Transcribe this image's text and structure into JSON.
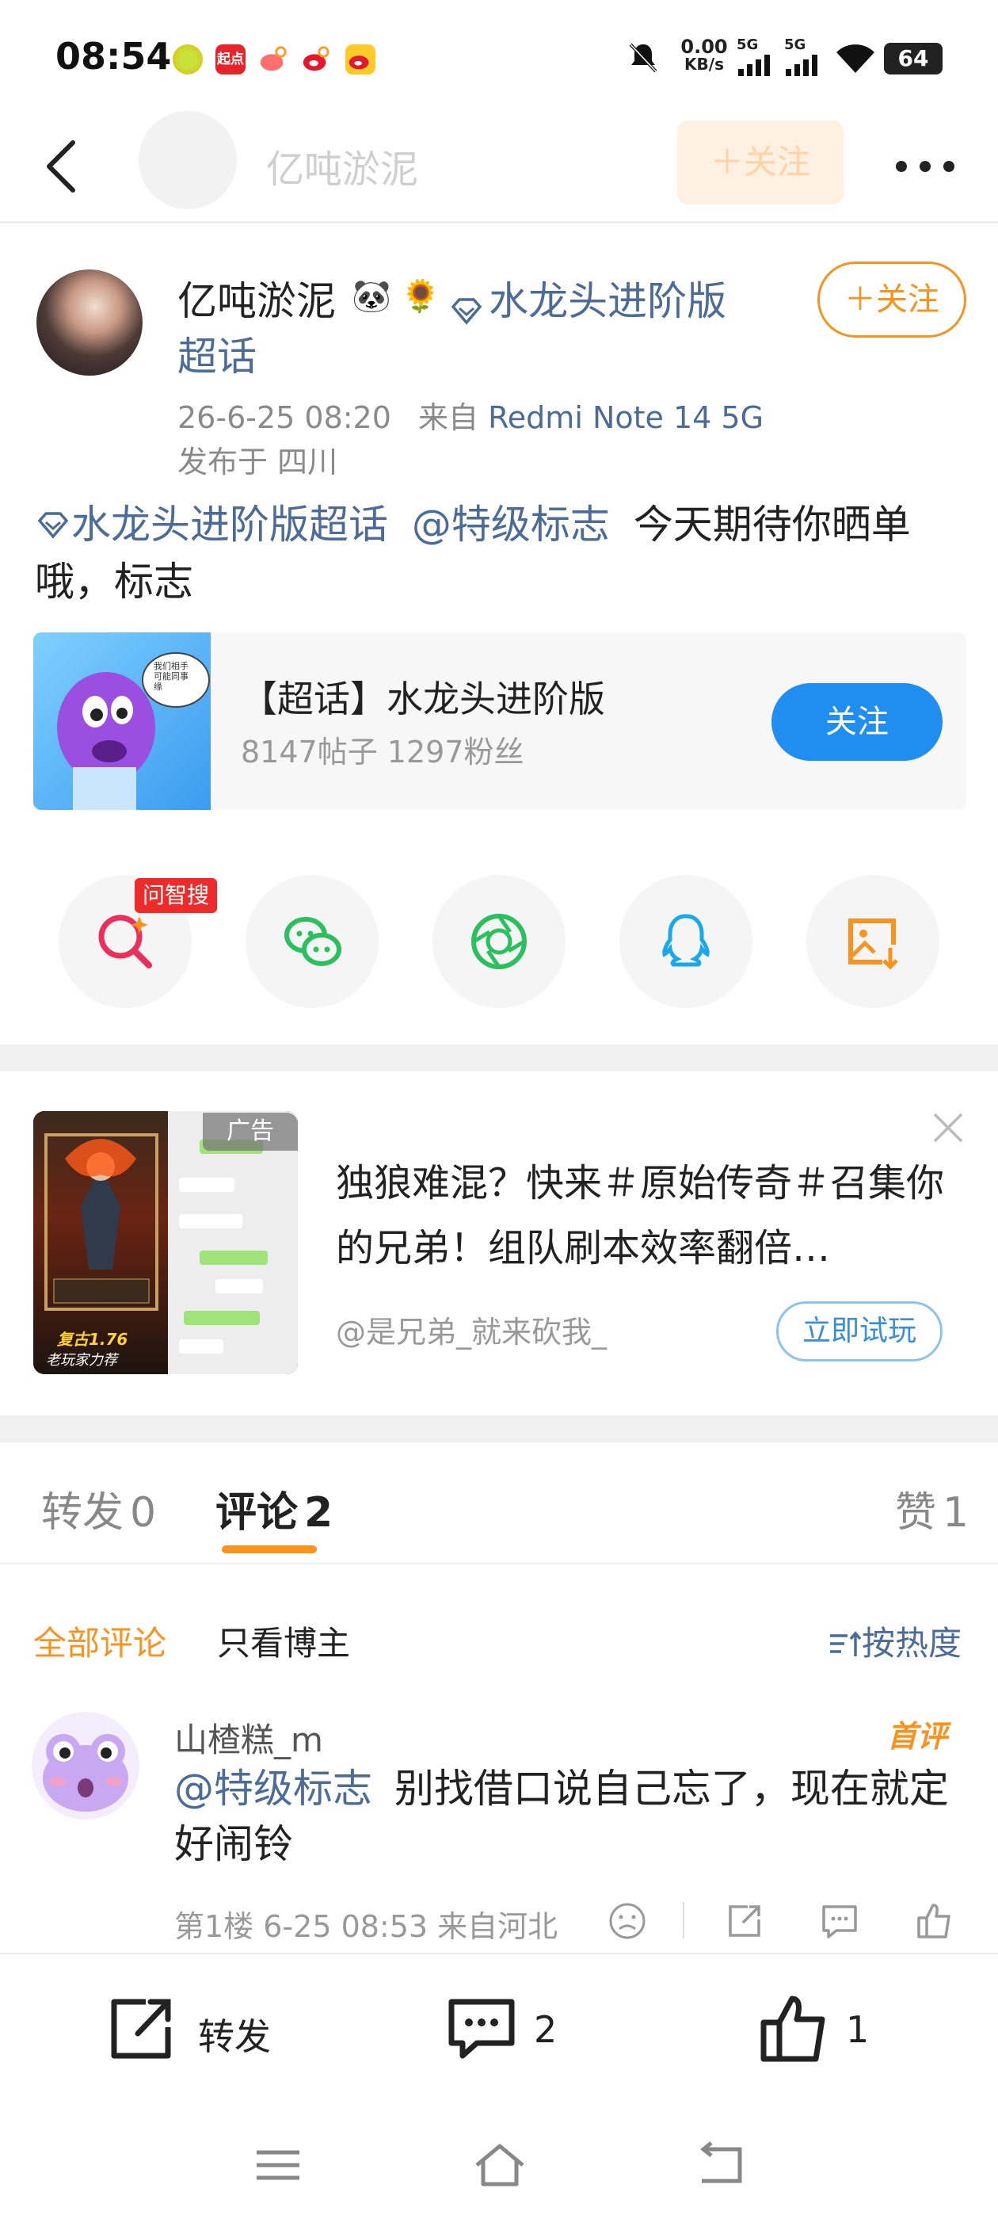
{
  "status_bar": {
    "time": "08:54",
    "speed_top": "0.00",
    "speed_unit": "KB/s",
    "net1": "5G",
    "net2": "5G",
    "battery": "64",
    "app_badge_text": "起点"
  },
  "nav": {
    "title": "亿吨淤泥",
    "follow_label": "＋关注"
  },
  "post": {
    "author": "亿吨淤泥",
    "emoji1": "🐼",
    "emoji2": "🌻",
    "supertopic_line1": "水龙头进阶版",
    "supertopic_line2": "超话",
    "follow_label": "＋关注",
    "time": "26-6-25 08:20",
    "from_label": "来自",
    "device": "Redmi Note 14 5G",
    "location": "发布于 四川",
    "body_topic": "水龙头进阶版超话",
    "body_mention": "@特级标志",
    "body_text": "今天期待你晒单哦，标志"
  },
  "topic_card": {
    "title": "【超话】水龙头进阶版",
    "stats": "8147帖子 1297粉丝",
    "follow_label": "关注",
    "bubble_text": "我们相手 可能同事 缘"
  },
  "share": {
    "ai_badge": "问智搜"
  },
  "ad": {
    "tag": "广告",
    "text": "独狼难混？快来＃原始传奇＃召集你的兄弟！组队刷本效率翻倍…",
    "account": "@是兄弟_就来砍我_",
    "cta": "立即试玩",
    "image_caption1": "复古1.76",
    "image_caption2": "老玩家力荐"
  },
  "tabs": {
    "repost": "转发",
    "repost_count": "0",
    "comment": "评论",
    "comment_count": "2",
    "like": "赞",
    "like_count": "1"
  },
  "filters": {
    "all": "全部评论",
    "author_only": "只看博主",
    "sort": "按热度"
  },
  "comment": {
    "user": "山楂糕_m",
    "badge": "首评",
    "mention": "@特级标志",
    "text": "别找借口说自己忘了，现在就定好闹铃",
    "meta": "第1楼 6-25 08:53 来自河北"
  },
  "bottom_bar": {
    "repost_label": "转发",
    "comment_count": "2",
    "like_count": "1"
  },
  "colors": {
    "accent_orange": "#f7931e",
    "link_blue": "#4c6b96",
    "button_blue": "#1f8ef0"
  }
}
